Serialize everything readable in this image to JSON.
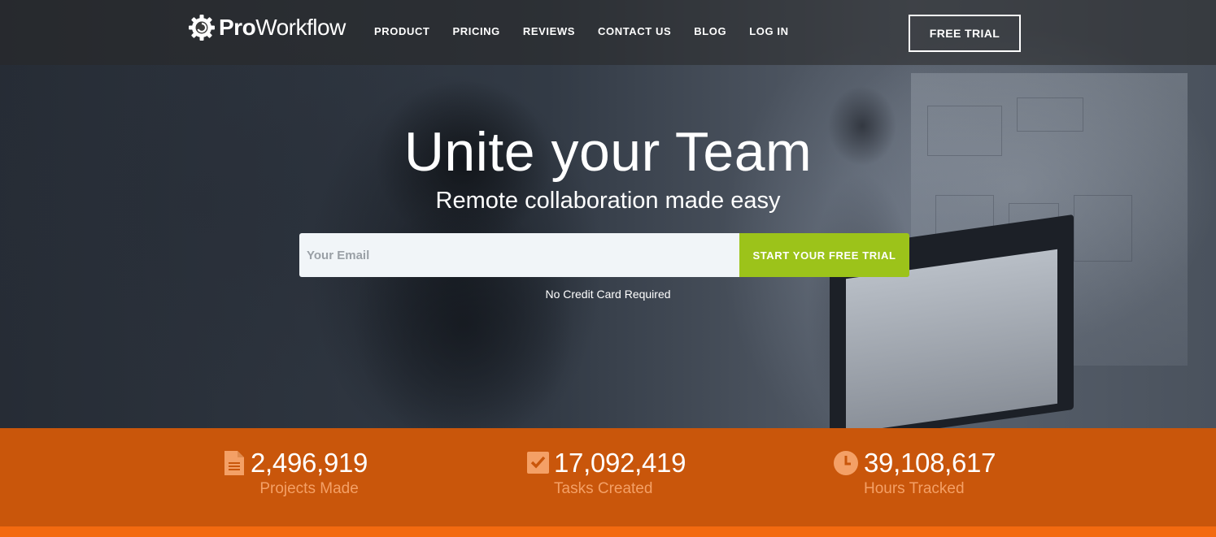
{
  "brand": {
    "name_bold": "Pro",
    "name_regular": "Workflow"
  },
  "nav": {
    "items": [
      {
        "label": "PRODUCT"
      },
      {
        "label": "PRICING"
      },
      {
        "label": "REVIEWS"
      },
      {
        "label": "CONTACT US"
      },
      {
        "label": "BLOG"
      },
      {
        "label": "LOG IN"
      }
    ],
    "free_trial_label": "FREE TRIAL"
  },
  "hero": {
    "headline": "Unite your Team",
    "subheadline": "Remote collaboration made easy",
    "email_placeholder": "Your Email",
    "email_value": "",
    "cta_label": "START YOUR FREE TRIAL",
    "note": "No Credit Card Required"
  },
  "stats": [
    {
      "icon": "document-icon",
      "value": "2,496,919",
      "label": "Projects Made"
    },
    {
      "icon": "checkbox-icon",
      "value": "17,092,419",
      "label": "Tasks Created"
    },
    {
      "icon": "clock-icon",
      "value": "39,108,617",
      "label": "Hours Tracked"
    }
  ],
  "colors": {
    "cta_green": "#9cc31a",
    "stats_orange": "#c9560b",
    "stats_label": "#f4a066",
    "icon_orange": "#f4a066"
  }
}
